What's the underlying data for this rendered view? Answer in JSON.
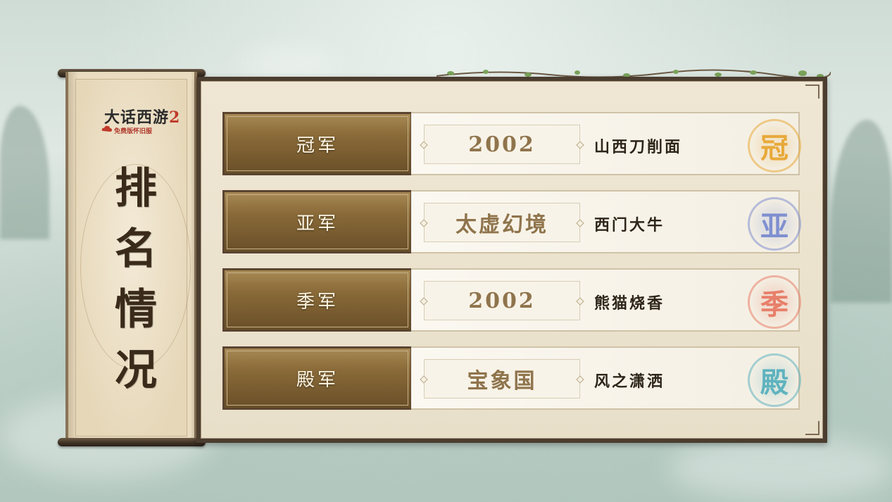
{
  "logo": {
    "title": "大话西游",
    "number": "2",
    "subtitle": "免费版怀旧服"
  },
  "sidebar": {
    "title_chars": [
      "排",
      "名",
      "情",
      "况"
    ]
  },
  "rankings": [
    {
      "rank": "冠军",
      "server": "2002",
      "team": "山西刀削面",
      "seal": "冠",
      "seal_color": "#e8a93a"
    },
    {
      "rank": "亚军",
      "server": "太虚幻境",
      "team": "西门大牛",
      "seal": "亚",
      "seal_color": "#7f8fd0"
    },
    {
      "rank": "季军",
      "server": "2002",
      "team": "熊猫烧香",
      "seal": "季",
      "seal_color": "#e77f6a"
    },
    {
      "rank": "殿军",
      "server": "宝象国",
      "team": "风之潇洒",
      "seal": "殿",
      "seal_color": "#5fb3bf"
    }
  ],
  "colors": {
    "gold_button": "#8a6b39",
    "frame": "#4b3d2f",
    "server_text": "#8f744c"
  }
}
